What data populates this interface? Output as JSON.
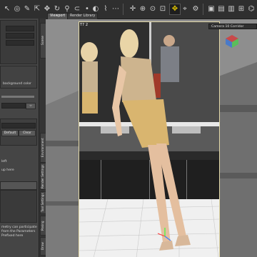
{
  "toolbar": {
    "icons": [
      "cursor-icon",
      "select-icon",
      "brush-icon",
      "node-select-icon",
      "translate-icon",
      "rotate-icon",
      "pin-icon",
      "magnet-icon",
      "dot-icon",
      "surface-icon",
      "dropper-icon",
      "dots-icon",
      "move-icon",
      "orbit-icon",
      "focus-icon",
      "frame-icon",
      "zoom-icon",
      "camera-icon",
      "render-icon",
      "cube-icon",
      "aspect-icon",
      "ortho-icon"
    ]
  },
  "viewport_tabs": {
    "active": "Viewport",
    "second": "Render Library"
  },
  "viewport": {
    "label": "T7  2",
    "camera_label": "Camera 10 Corridor",
    "colors": {
      "frame": "#e3d9a8",
      "dress": "#d9b56f"
    }
  },
  "left_pane": {
    "text_1": "background color",
    "btn_default": "Default",
    "btn_clear": "Clear",
    "text_left": "left",
    "text_up": "up here",
    "note_1": "metry can participate",
    "note_2": "from the Parameters",
    "note_3": "Prefixed here"
  },
  "side_tabs": [
    "Scene",
    "Environment",
    "Render Settings",
    "Tool Settings",
    "Posing",
    "Draw"
  ]
}
